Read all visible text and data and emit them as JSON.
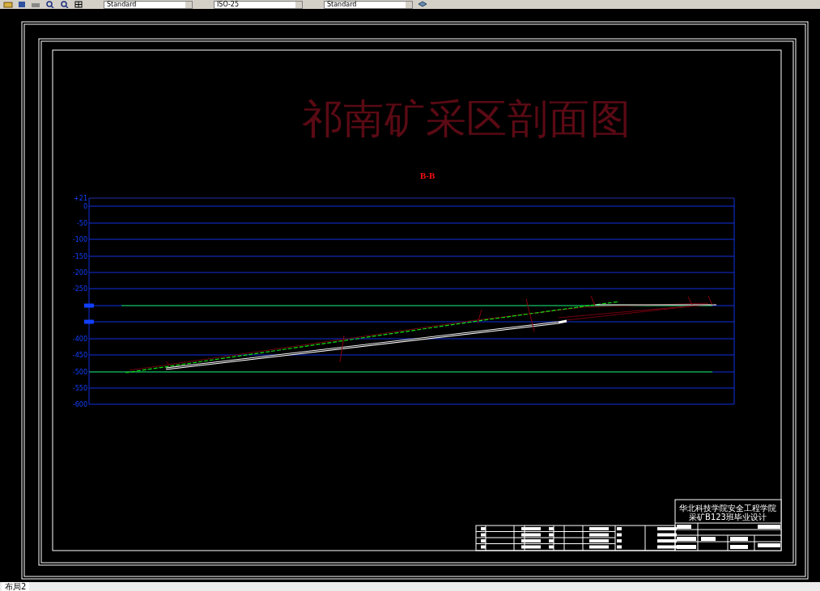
{
  "toolbar": {
    "dropdowns": [
      "Standard",
      "ISO-25",
      "Standard"
    ]
  },
  "drawing": {
    "title": "祁南矿采区剖面图",
    "section_label": "B-B",
    "axis_labels": [
      {
        "kind": "label",
        "text": "+21"
      },
      {
        "kind": "label",
        "text": "0"
      },
      {
        "kind": "label",
        "text": "-50"
      },
      {
        "kind": "label",
        "text": "-100"
      },
      {
        "kind": "label",
        "text": "-150"
      },
      {
        "kind": "label",
        "text": "-200"
      },
      {
        "kind": "label",
        "text": "-250"
      },
      {
        "kind": "block"
      },
      {
        "kind": "block"
      },
      {
        "kind": "label",
        "text": "-400"
      },
      {
        "kind": "label",
        "text": "-450"
      },
      {
        "kind": "label",
        "text": "-500"
      },
      {
        "kind": "label",
        "text": "-550"
      },
      {
        "kind": "label",
        "text": "-600"
      }
    ],
    "title_block": {
      "school": "华北科技学院安全工程学院",
      "project": "采矿B123班毕业设计"
    }
  },
  "layout_tabs": [
    {
      "label": "布局2",
      "selected": true
    }
  ]
}
